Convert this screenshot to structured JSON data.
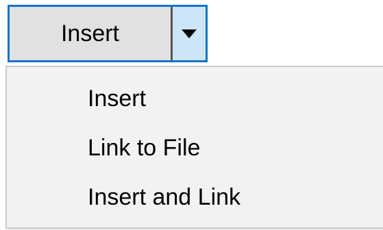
{
  "split_button": {
    "label": "Insert",
    "arrow_icon": "chevron-down-icon",
    "border_color": "#1473cc",
    "arrow_bg": "#cde6f7"
  },
  "menu": {
    "items": [
      {
        "label": "Insert"
      },
      {
        "label": "Link to File"
      },
      {
        "label": "Insert and Link"
      }
    ]
  }
}
